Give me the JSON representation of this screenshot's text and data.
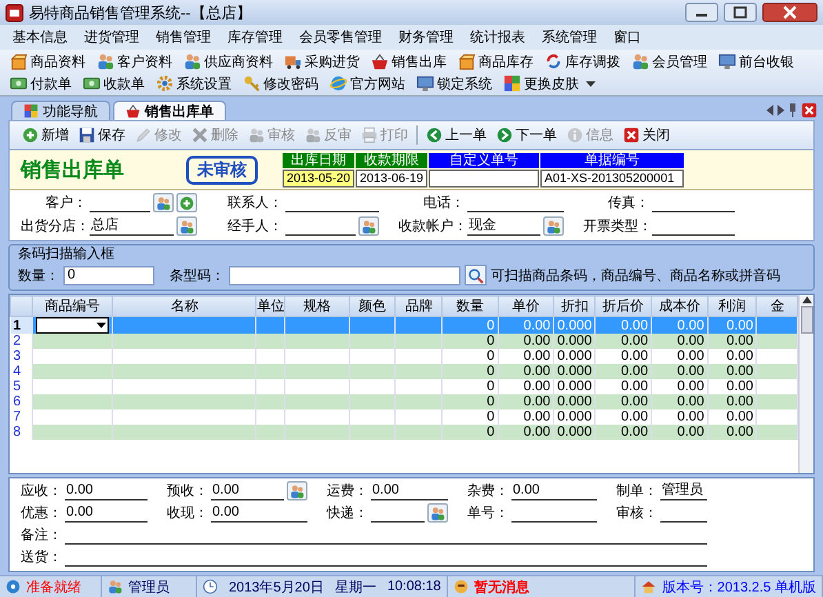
{
  "window": {
    "title": "易特商品销售管理系统--【总店】"
  },
  "menu": [
    "基本信息",
    "进货管理",
    "销售管理",
    "库存管理",
    "会员零售管理",
    "财务管理",
    "统计报表",
    "系统管理",
    "窗口"
  ],
  "toolbar": [
    "商品资料",
    "客户资料",
    "供应商资料",
    "采购进货",
    "销售出库",
    "商品库存",
    "库存调拨",
    "会员管理",
    "前台收银",
    "付款单",
    "收款单",
    "系统设置",
    "修改密码",
    "官方网站",
    "锁定系统",
    "更换皮肤"
  ],
  "tabs": [
    {
      "label": "功能导航",
      "selected": false
    },
    {
      "label": "销售出库单",
      "selected": true
    }
  ],
  "actions": [
    {
      "label": "新增",
      "disabled": false
    },
    {
      "label": "保存",
      "disabled": false
    },
    {
      "label": "修改",
      "disabled": true
    },
    {
      "label": "删除",
      "disabled": true
    },
    {
      "label": "审核",
      "disabled": true
    },
    {
      "label": "反审",
      "disabled": true
    },
    {
      "label": "打印",
      "disabled": true
    },
    {
      "label": "上一单",
      "disabled": false
    },
    {
      "label": "下一单",
      "disabled": false
    },
    {
      "label": "信息",
      "disabled": true
    },
    {
      "label": "关闭",
      "disabled": false
    }
  ],
  "document": {
    "title": "销售出库单",
    "stamp": "未审核",
    "fields": [
      {
        "label": "出库日期",
        "value": "2013-05-20",
        "color": "#008000",
        "focused": true
      },
      {
        "label": "收款期限",
        "value": "2013-06-19",
        "color": "#008000",
        "focused": false
      },
      {
        "label": "自定义单号",
        "color": "#0000ff",
        "focused": false
      },
      {
        "label": "单据编号",
        "value": "A01-XS-201305200001",
        "color": "#0000ff",
        "focused": false
      }
    ]
  },
  "form": [
    {
      "label": "客户：",
      "kind": "picker-add"
    },
    {
      "label": "联系人：",
      "kind": "plain"
    },
    {
      "label": "电话：",
      "kind": "plain"
    },
    {
      "label": "传真：",
      "kind": "plain"
    },
    {
      "label": "出货分店：",
      "value": "总店",
      "kind": "picker"
    },
    {
      "label": "经手人：",
      "kind": "picker"
    },
    {
      "label": "收款帐户：",
      "value": "现金",
      "kind": "picker"
    },
    {
      "label": "开票类型：",
      "kind": "plain"
    }
  ],
  "barcode": {
    "title": "条码扫描输入框",
    "quantity_label": "数量：",
    "quantity": "0",
    "code_label": "条型码：",
    "hint": "可扫描商品条码，商品编号、商品名称或拼音码"
  },
  "table": {
    "columns": [
      "商品编号",
      "名称",
      "单位",
      "规格",
      "颜色",
      "品牌",
      "数量",
      "单价",
      "折扣",
      "折后价",
      "成本价",
      "利润",
      "金"
    ],
    "rows": [
      {
        "number": "1",
        "selected": true,
        "quantity": "0",
        "price": "0.00",
        "discount": "0.000",
        "discounted": "0.00",
        "cost": "0.00",
        "profit": "0.00"
      },
      {
        "number": "2",
        "selected": false,
        "quantity": "0",
        "price": "0.00",
        "discount": "0.000",
        "discounted": "0.00",
        "cost": "0.00",
        "profit": "0.00"
      },
      {
        "number": "3",
        "selected": false,
        "quantity": "0",
        "price": "0.00",
        "discount": "0.000",
        "discounted": "0.00",
        "cost": "0.00",
        "profit": "0.00"
      },
      {
        "number": "4",
        "selected": false,
        "quantity": "0",
        "price": "0.00",
        "discount": "0.000",
        "discounted": "0.00",
        "cost": "0.00",
        "profit": "0.00"
      },
      {
        "number": "5",
        "selected": false,
        "quantity": "0",
        "price": "0.00",
        "discount": "0.000",
        "discounted": "0.00",
        "cost": "0.00",
        "profit": "0.00"
      },
      {
        "number": "6",
        "selected": false,
        "quantity": "0",
        "price": "0.00",
        "discount": "0.000",
        "discounted": "0.00",
        "cost": "0.00",
        "profit": "0.00"
      },
      {
        "number": "7",
        "selected": false,
        "quantity": "0",
        "price": "0.00",
        "discount": "0.000",
        "discounted": "0.00",
        "cost": "0.00",
        "profit": "0.00"
      },
      {
        "number": "8",
        "selected": false,
        "quantity": "0",
        "price": "0.00",
        "discount": "0.000",
        "discounted": "0.00",
        "cost": "0.00",
        "profit": "0.00"
      }
    ]
  },
  "footer": [
    {
      "label": "应收：",
      "value": "0.00",
      "kind": "plain"
    },
    {
      "label": "预收：",
      "value": "0.00",
      "kind": "picker"
    },
    {
      "label": "运费：",
      "value": "0.00",
      "kind": "plain"
    },
    {
      "label": "杂费：",
      "value": "0.00",
      "kind": "plain"
    },
    {
      "label": "制单：",
      "value": "管理员",
      "kind": "plain"
    },
    {
      "label": "优惠：",
      "value": "0.00",
      "kind": "plain"
    },
    {
      "label": "收现：",
      "value": "0.00",
      "kind": "plain"
    },
    {
      "label": "快递：",
      "kind": "picker"
    },
    {
      "label": "单号：",
      "kind": "plain"
    },
    {
      "label": "审核：",
      "kind": "plain"
    },
    {
      "label": "备注：",
      "kind": "wide"
    },
    {
      "label": "送货：",
      "kind": "wide"
    }
  ],
  "status_bar": [
    {
      "texts": [
        "准备就绪"
      ],
      "color": "#ff0000"
    },
    {
      "texts": [
        "管理员"
      ],
      "color": "#000060"
    },
    {
      "texts": [
        "2013年5月20日",
        "星期一",
        "10:08:18"
      ],
      "color": "#000060"
    },
    {
      "texts": [
        "暂无消息"
      ],
      "color": "#ff0000"
    },
    {
      "texts": [
        "版本号：2013.2.5 单机版"
      ],
      "color": "#0000ff"
    }
  ]
}
